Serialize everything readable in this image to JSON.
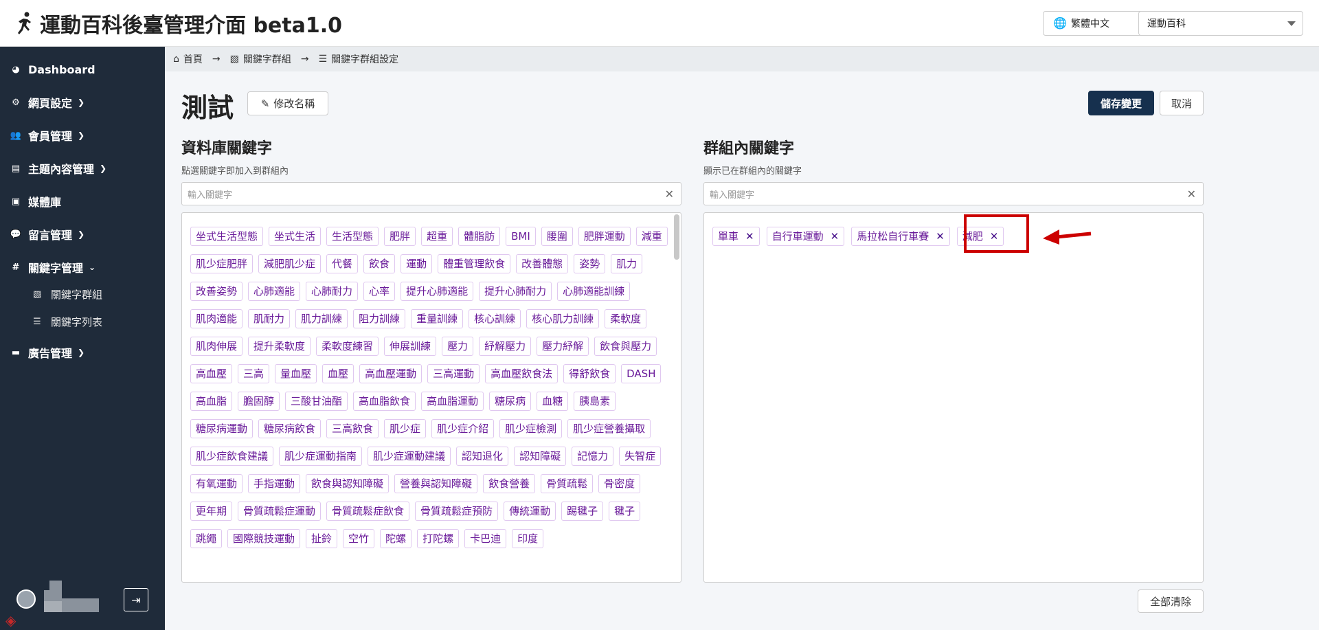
{
  "header": {
    "title": "運動百科後臺管理介面 beta1.0",
    "language": "繁體中文",
    "site": "運動百科"
  },
  "sidebar": {
    "items": [
      {
        "label": "Dashboard",
        "icon": "dashboard-icon"
      },
      {
        "label": "網頁設定",
        "icon": "gear-icon"
      },
      {
        "label": "會員管理",
        "icon": "users-icon"
      },
      {
        "label": "主題內容管理",
        "icon": "book-icon"
      },
      {
        "label": "媒體庫",
        "icon": "images-icon"
      },
      {
        "label": "留言管理",
        "icon": "comment-icon"
      },
      {
        "label": "關鍵字管理",
        "icon": "hashtag-icon"
      },
      {
        "label": "廣告管理",
        "icon": "ad-icon"
      }
    ],
    "subitems": [
      {
        "label": "關鍵字群組",
        "icon": "image-icon"
      },
      {
        "label": "關鍵字列表",
        "icon": "list-icon"
      }
    ]
  },
  "breadcrumb": {
    "home": "首頁",
    "group": "關鍵字群組",
    "current": "關鍵字群組設定"
  },
  "page": {
    "title": "測試",
    "rename_label": "修改名稱",
    "save_label": "儲存變更",
    "cancel_label": "取消",
    "clear_all_label": "全部清除"
  },
  "database": {
    "title": "資料庫關鍵字",
    "desc": "點選關鍵字即加入到群組內",
    "placeholder": "輸入關鍵字",
    "tags": [
      "坐式生活型態",
      "坐式生活",
      "生活型態",
      "肥胖",
      "超重",
      "體脂肪",
      "BMI",
      "腰圍",
      "肥胖運動",
      "減重",
      "肌少症肥胖",
      "減肥肌少症",
      "代餐",
      "飲食",
      "運動",
      "體重管理飲食",
      "改善體態",
      "姿勢",
      "肌力",
      "改善姿勢",
      "心肺適能",
      "心肺耐力",
      "心率",
      "提升心肺適能",
      "提升心肺耐力",
      "心肺適能訓練",
      "肌肉適能",
      "肌耐力",
      "肌力訓練",
      "阻力訓練",
      "重量訓練",
      "核心訓練",
      "核心肌力訓練",
      "柔軟度",
      "肌肉伸展",
      "提升柔軟度",
      "柔軟度練習",
      "伸展訓練",
      "壓力",
      "紓解壓力",
      "壓力紓解",
      "飲食與壓力",
      "高血壓",
      "三高",
      "量血壓",
      "血壓",
      "高血壓運動",
      "三高運動",
      "高血壓飲食法",
      "得舒飲食",
      "DASH",
      "高血脂",
      "膽固醇",
      "三酸甘油酯",
      "高血脂飲食",
      "高血脂運動",
      "糖尿病",
      "血糖",
      "胰島素",
      "糖尿病運動",
      "糖尿病飲食",
      "三高飲食",
      "肌少症",
      "肌少症介紹",
      "肌少症檢測",
      "肌少症營養攝取",
      "肌少症飲食建議",
      "肌少症運動指南",
      "肌少症運動建議",
      "認知退化",
      "認知障礙",
      "記憶力",
      "失智症",
      "有氧運動",
      "手指運動",
      "飲食與認知障礙",
      "營養與認知障礙",
      "飲食營養",
      "骨質疏鬆",
      "骨密度",
      "更年期",
      "骨質疏鬆症運動",
      "骨質疏鬆症飲食",
      "骨質疏鬆症預防",
      "傳統運動",
      "踢毽子",
      "毽子",
      "跳繩",
      "國際競技運動",
      "扯鈴",
      "空竹",
      "陀螺",
      "打陀螺",
      "卡巴迪",
      "印度"
    ]
  },
  "group": {
    "title": "群組內關鍵字",
    "desc": "顯示已在群組內的關鍵字",
    "placeholder": "輸入關鍵字",
    "tags": [
      "單車",
      "自行車運動",
      "馬拉松自行車賽",
      "減肥"
    ]
  },
  "colors": {
    "sidebar_bg": "#1f2b3a",
    "primary": "#16304e",
    "tag_text": "#6a1b9a",
    "highlight": "#cc0000"
  }
}
